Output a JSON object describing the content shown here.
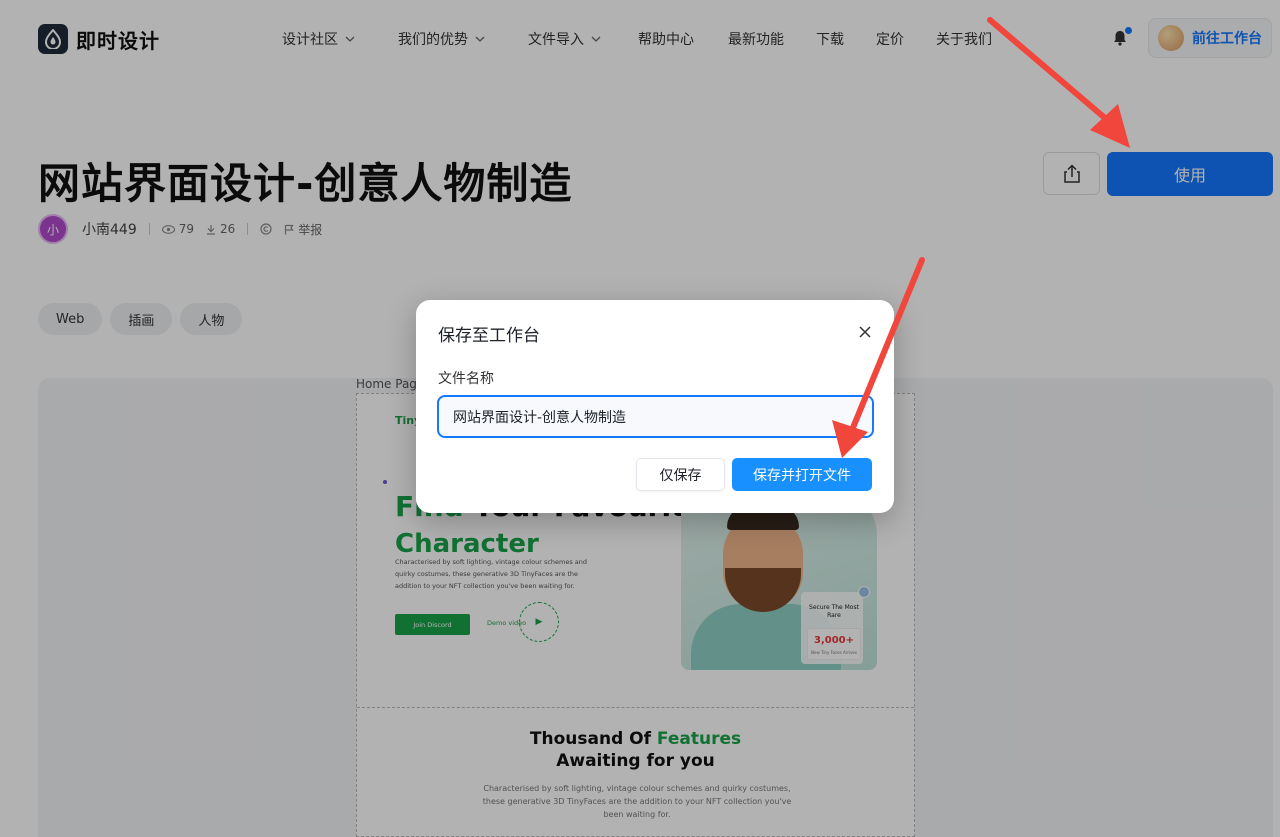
{
  "nav": {
    "logo_text": "即时设计",
    "menu": [
      {
        "label": "设计社区",
        "has_dropdown": true
      },
      {
        "label": "我们的优势",
        "has_dropdown": true
      },
      {
        "label": "文件导入",
        "has_dropdown": true
      },
      {
        "label": "帮助中心",
        "has_dropdown": false
      },
      {
        "label": "最新功能",
        "has_dropdown": false
      },
      {
        "label": "下载",
        "has_dropdown": false
      },
      {
        "label": "定价",
        "has_dropdown": false
      },
      {
        "label": "关于我们",
        "has_dropdown": false
      }
    ],
    "workspace_button": "前往工作台"
  },
  "header": {
    "title": "网站界面设计-创意人物制造",
    "author_avatar": "小",
    "author": "小南449",
    "views": "79",
    "downloads": "26",
    "report": "举报",
    "use_button": "使用"
  },
  "tags": [
    "Web",
    "插画",
    "人物"
  ],
  "preview": {
    "page_label": "Home Page",
    "brand": "TinyFaces",
    "hero_line1_green": "Find",
    "hero_line1_rest": " Your Favourite",
    "hero_line2": "Character",
    "hero_desc": "Characterised by soft lighting, vintage colour schemes and quirky costumes, these generative 3D TinyFaces are the addition to your NFT collection you've been waiting for.",
    "join_button": "Join Discord",
    "demo_link": "Demo video",
    "stat_title": "Secure The Most Rare",
    "stat_number": "3,000+",
    "stat_sub": "New Tiny Faces Arrives",
    "features_title_a": "Thousand Of ",
    "features_title_green": "Features",
    "features_title_b": "Awaiting for you",
    "features_desc": "Characterised by soft lighting, vintage colour schemes and quirky costumes, these generative 3D TinyFaces are the addition to your NFT collection you've been waiting for."
  },
  "modal": {
    "title": "保存至工作台",
    "field_label": "文件名称",
    "field_value": "网站界面设计-创意人物制造",
    "save_only": "仅保存",
    "save_and_open": "保存并打开文件"
  },
  "colors": {
    "primary": "#1677ff",
    "annotation_arrow": "#f0463c",
    "preview_green": "#19a34a"
  }
}
